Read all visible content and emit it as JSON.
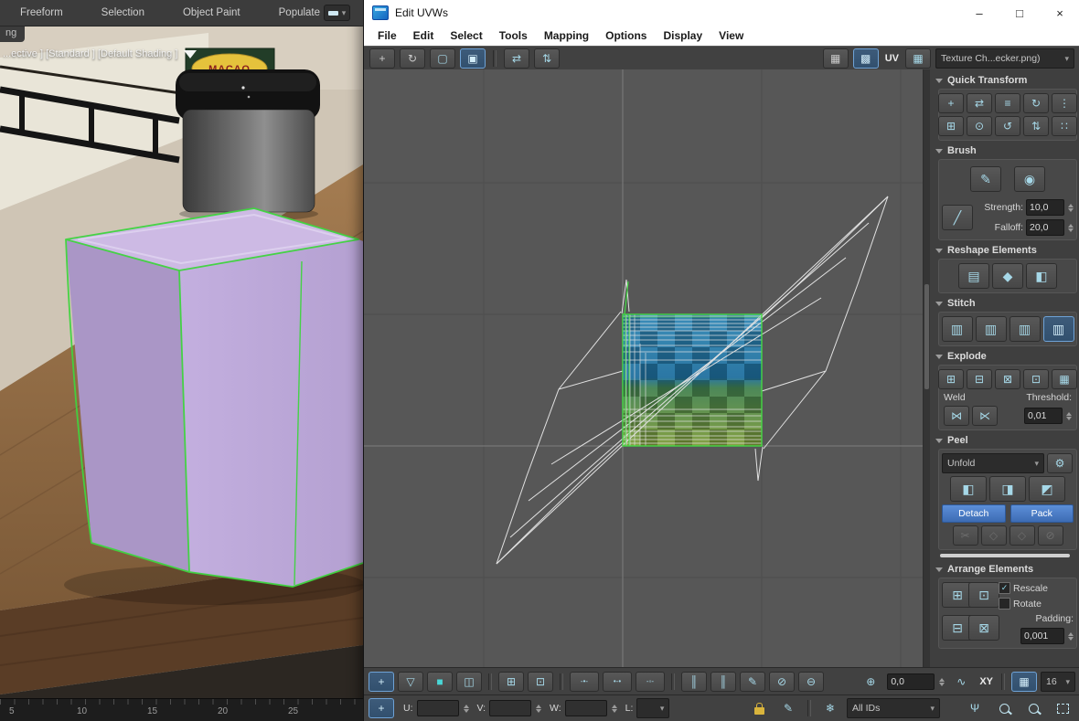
{
  "ribbon": {
    "tabs": [
      "Freeform",
      "Selection",
      "Object Paint",
      "Populate"
    ],
    "partial_tab": "ng"
  },
  "viewport": {
    "label": "...ective ] [Standard ] [Default Shading ]",
    "package_title": "МАСАО",
    "ruler_ticks": [
      "5",
      "10",
      "15",
      "20",
      "25"
    ]
  },
  "uvw": {
    "title": "Edit UVWs",
    "menus": [
      "File",
      "Edit",
      "Select",
      "Tools",
      "Mapping",
      "Options",
      "Display",
      "View"
    ],
    "toolbar": {
      "uv_label": "UV",
      "texture_selector": "Texture Ch...ecker.png)"
    },
    "panel": {
      "quick_transform": {
        "title": "Quick Transform"
      },
      "brush": {
        "title": "Brush",
        "strength_label": "Strength:",
        "strength_value": "10,0",
        "falloff_label": "Falloff:",
        "falloff_value": "20,0"
      },
      "reshape": {
        "title": "Reshape Elements"
      },
      "stitch": {
        "title": "Stitch"
      },
      "explode": {
        "title": "Explode",
        "weld_label": "Weld",
        "threshold_label": "Threshold:",
        "threshold_value": "0,01"
      },
      "peel": {
        "title": "Peel",
        "mode_value": "Unfold",
        "detach_label": "Detach",
        "pack_label": "Pack"
      },
      "arrange": {
        "title": "Arrange Elements",
        "rescale_label": "Rescale",
        "rotate_label": "Rotate",
        "padding_label": "Padding:",
        "padding_value": "0,001"
      }
    },
    "status": {
      "coord_value": "0,0",
      "axis_label": "XY",
      "grid_value": "16",
      "u_label": "U:",
      "v_label": "V:",
      "w_label": "W:",
      "l_label": "L:",
      "all_ids_label": "All IDs"
    }
  },
  "colors": {
    "selection_green": "#3fd43f",
    "accent_blue": "#4a86c8",
    "icon_teal": "#a6d8e8",
    "lock_gold": "#d9b43c",
    "canvas_gray": "#575757"
  },
  "icons": {
    "win_min": "–",
    "win_max": "□",
    "win_close": "×",
    "dropdown_arrow": "▾",
    "move": "+",
    "rotate": "↻",
    "freeform_dashed": "▢",
    "freeform_active": "▣",
    "mirror_h": "⇄",
    "mirror_v": "⇅",
    "checker": "▦",
    "checker_active": "▩",
    "show_map": "▦",
    "qt": [
      "+",
      "⇄",
      "≡",
      "↻",
      "⋮",
      "⊞",
      "⊙",
      "↺",
      "⇅",
      "∷"
    ],
    "brush_paint": "✎",
    "brush_sphere": "◉",
    "brush_line": "╱",
    "reshape": [
      "▤",
      "◆",
      "◧"
    ],
    "stitch": [
      "▥",
      "▥",
      "▥",
      "▥"
    ],
    "explode": [
      "⊞",
      "⊟",
      "⊠",
      "⊡",
      "▦"
    ],
    "weld": [
      "⋈",
      "⋉"
    ],
    "gear": "⚙",
    "peel": [
      "◧",
      "◨",
      "◩"
    ],
    "peel_gray": [
      "✂",
      "◇",
      "◇",
      "⊘"
    ],
    "arrange": [
      "⊞",
      "⊡",
      "⊟",
      "⊠"
    ],
    "check": "✓",
    "b1": [
      "+",
      "▽",
      "■",
      "◫",
      "⊞",
      "⊡",
      "-•-",
      "•-•",
      "-◦-",
      "║",
      "║",
      "✎",
      "⊘",
      "⊖"
    ],
    "pivot": "⊕",
    "curve": "∿",
    "gridlock": "▦",
    "pan": "+",
    "hand": "Ψ",
    "snowflake": "❄",
    "pencil": "✎"
  }
}
